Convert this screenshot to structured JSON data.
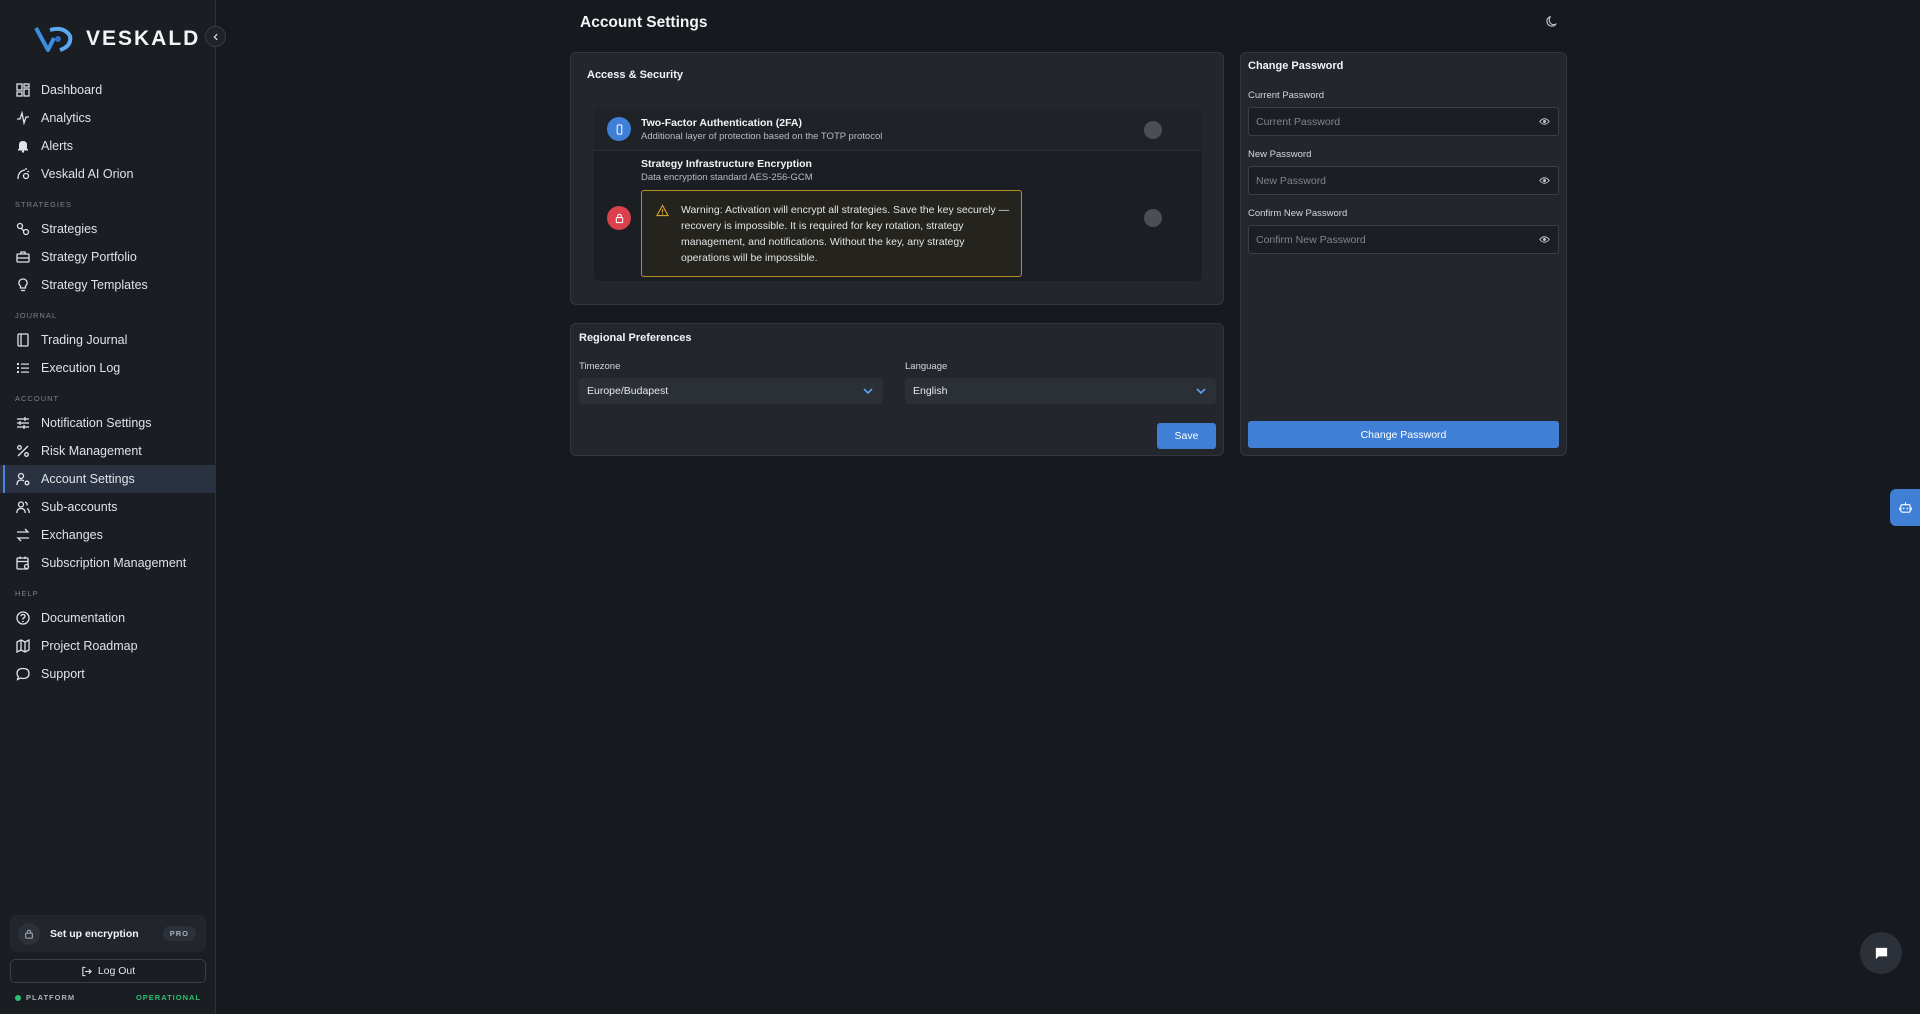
{
  "brand": {
    "name": "VESKALD"
  },
  "sidebar": {
    "top_items": [
      {
        "label": "Dashboard",
        "icon": "dashboard-icon"
      },
      {
        "label": "Analytics",
        "icon": "analytics-icon"
      },
      {
        "label": "Alerts",
        "icon": "bell-icon"
      },
      {
        "label": "Veskald AI Orion",
        "icon": "orion-icon"
      }
    ],
    "sections": [
      {
        "label": "STRATEGIES",
        "items": [
          {
            "label": "Strategies",
            "icon": "strategies-icon"
          },
          {
            "label": "Strategy Portfolio",
            "icon": "briefcase-icon"
          },
          {
            "label": "Strategy Templates",
            "icon": "lightbulb-icon"
          }
        ]
      },
      {
        "label": "JOURNAL",
        "items": [
          {
            "label": "Trading Journal",
            "icon": "book-icon"
          },
          {
            "label": "Execution Log",
            "icon": "list-icon"
          }
        ]
      },
      {
        "label": "ACCOUNT",
        "items": [
          {
            "label": "Notification Settings",
            "icon": "sliders-icon"
          },
          {
            "label": "Risk Management",
            "icon": "percent-icon"
          },
          {
            "label": "Account Settings",
            "icon": "user-gear-icon",
            "active": true
          },
          {
            "label": "Sub-accounts",
            "icon": "users-icon"
          },
          {
            "label": "Exchanges",
            "icon": "exchange-icon"
          },
          {
            "label": "Subscription Management",
            "icon": "calendar-icon"
          }
        ]
      },
      {
        "label": "HELP",
        "items": [
          {
            "label": "Documentation",
            "icon": "help-circle-icon"
          },
          {
            "label": "Project Roadmap",
            "icon": "map-icon"
          },
          {
            "label": "Support",
            "icon": "chat-bubble-icon"
          }
        ]
      }
    ],
    "encryption_card": {
      "label": "Set up encryption",
      "badge": "PRO"
    },
    "logout_label": "Log Out",
    "platform": {
      "label": "PLATFORM",
      "status": "OPERATIONAL"
    }
  },
  "page": {
    "title": "Account Settings"
  },
  "access_security": {
    "title": "Access & Security",
    "two_factor": {
      "title": "Two-Factor Authentication (2FA)",
      "subtitle": "Additional layer of protection based on the TOTP protocol"
    },
    "encryption": {
      "title": "Strategy Infrastructure Encryption",
      "subtitle": "Data encryption standard AES-256-GCM",
      "warning": "Warning: Activation will encrypt all strategies. Save the key securely — recovery is impossible. It is required for key rotation, strategy management, and notifications. Without the key, any strategy operations will be impossible."
    }
  },
  "regional": {
    "title": "Regional Preferences",
    "timezone_label": "Timezone",
    "timezone_value": "Europe/Budapest",
    "language_label": "Language",
    "language_value": "English",
    "save_label": "Save"
  },
  "change_password": {
    "title": "Change Password",
    "current_label": "Current Password",
    "current_placeholder": "Current Password",
    "new_label": "New Password",
    "new_placeholder": "New Password",
    "confirm_label": "Confirm New Password",
    "confirm_placeholder": "Confirm New Password",
    "button_label": "Change Password"
  },
  "colors": {
    "accent": "#3f7fd6",
    "danger": "#d9414c",
    "warning": "#b88f26",
    "operational": "#2fbf71"
  }
}
